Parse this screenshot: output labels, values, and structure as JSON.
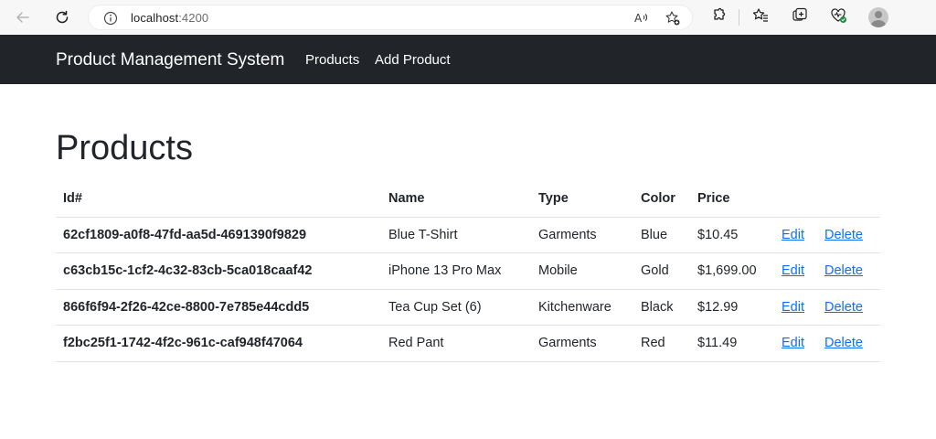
{
  "browser": {
    "url_host": "localhost",
    "url_port": ":4200"
  },
  "navbar": {
    "brand": "Product Management System",
    "links": [
      "Products",
      "Add Product"
    ]
  },
  "page": {
    "title": "Products"
  },
  "table": {
    "headers": [
      "Id#",
      "Name",
      "Type",
      "Color",
      "Price"
    ],
    "edit_label": "Edit",
    "delete_label": "Delete",
    "rows": [
      {
        "id": "62cf1809-a0f8-47fd-aa5d-4691390f9829",
        "name": "Blue T-Shirt",
        "type": "Garments",
        "color": "Blue",
        "price": "$10.45"
      },
      {
        "id": "c63cb15c-1cf2-4c32-83cb-5ca018caaf42",
        "name": "iPhone 13 Pro Max",
        "type": "Mobile",
        "color": "Gold",
        "price": "$1,699.00"
      },
      {
        "id": "866f6f94-2f26-42ce-8800-7e785e44cdd5",
        "name": "Tea Cup Set (6)",
        "type": "Kitchenware",
        "color": "Black",
        "price": "$12.99"
      },
      {
        "id": "f2bc25f1-1742-4f2c-961c-caf948f47064",
        "name": "Red Pant",
        "type": "Garments",
        "color": "Red",
        "price": "$11.49"
      }
    ]
  },
  "icons": {
    "back": "back-arrow-icon",
    "refresh": "refresh-icon",
    "info": "info-icon",
    "read_aloud": "read-aloud-icon",
    "add_favorite": "add-favorite-icon",
    "extensions": "extensions-icon",
    "favorites": "favorites-icon",
    "collections": "collections-icon",
    "browser_essentials": "browser-essentials-icon",
    "profile": "avatar"
  },
  "colors": {
    "navbar_bg": "#212529",
    "link": "#0d6efd"
  }
}
